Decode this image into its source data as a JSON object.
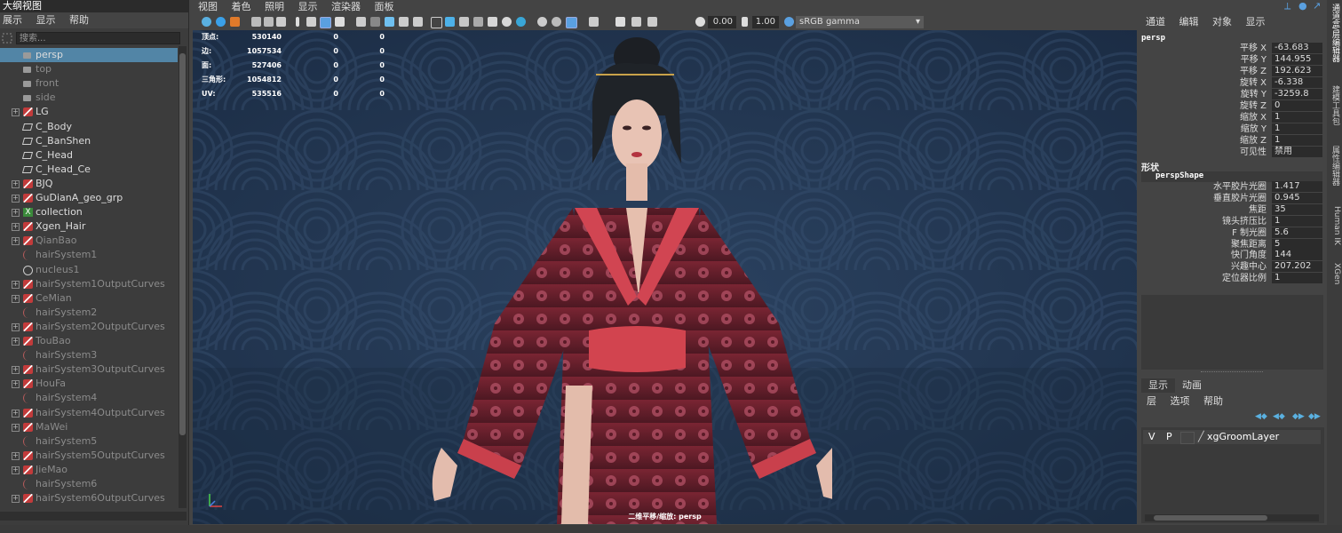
{
  "outliner": {
    "title": "大纲视图",
    "menu": [
      "展示",
      "显示",
      "帮助"
    ],
    "search_placeholder": "搜索...",
    "items": [
      {
        "label": "persp",
        "icon": "camera-icon",
        "selected": true,
        "dim": false,
        "expand": false
      },
      {
        "label": "top",
        "icon": "camera-icon",
        "selected": false,
        "dim": true,
        "expand": false
      },
      {
        "label": "front",
        "icon": "camera-icon",
        "selected": false,
        "dim": true,
        "expand": false
      },
      {
        "label": "side",
        "icon": "camera-icon",
        "selected": false,
        "dim": true,
        "expand": false
      },
      {
        "label": "LG",
        "icon": "group-icon",
        "selected": false,
        "dim": false,
        "expand": true
      },
      {
        "label": "C_Body",
        "icon": "mesh-icon",
        "selected": false,
        "dim": false,
        "expand": false
      },
      {
        "label": "C_BanShen",
        "icon": "mesh-icon",
        "selected": false,
        "dim": false,
        "expand": false
      },
      {
        "label": "C_Head",
        "icon": "mesh-icon",
        "selected": false,
        "dim": false,
        "expand": false
      },
      {
        "label": "C_Head_Ce",
        "icon": "mesh-icon",
        "selected": false,
        "dim": false,
        "expand": false
      },
      {
        "label": "BJQ",
        "icon": "group-icon",
        "selected": false,
        "dim": false,
        "expand": true
      },
      {
        "label": "GuDianA_geo_grp",
        "icon": "group-icon",
        "selected": false,
        "dim": false,
        "expand": true
      },
      {
        "label": "collection",
        "icon": "collection-icon",
        "selected": false,
        "dim": false,
        "expand": true
      },
      {
        "label": "Xgen_Hair",
        "icon": "group-icon",
        "selected": false,
        "dim": false,
        "expand": true
      },
      {
        "label": "QianBao",
        "icon": "group-icon",
        "selected": false,
        "dim": true,
        "expand": true
      },
      {
        "label": "hairSystem1",
        "icon": "curve-icon",
        "selected": false,
        "dim": true,
        "expand": false
      },
      {
        "label": "nucleus1",
        "icon": "nucleus-icon",
        "selected": false,
        "dim": true,
        "expand": false
      },
      {
        "label": "hairSystem1OutputCurves",
        "icon": "group-icon",
        "selected": false,
        "dim": true,
        "expand": true
      },
      {
        "label": "CeMian",
        "icon": "group-icon",
        "selected": false,
        "dim": true,
        "expand": true
      },
      {
        "label": "hairSystem2",
        "icon": "curve-icon",
        "selected": false,
        "dim": true,
        "expand": false
      },
      {
        "label": "hairSystem2OutputCurves",
        "icon": "group-icon",
        "selected": false,
        "dim": true,
        "expand": true
      },
      {
        "label": "TouBao",
        "icon": "group-icon",
        "selected": false,
        "dim": true,
        "expand": true
      },
      {
        "label": "hairSystem3",
        "icon": "curve-icon",
        "selected": false,
        "dim": true,
        "expand": false
      },
      {
        "label": "hairSystem3OutputCurves",
        "icon": "group-icon",
        "selected": false,
        "dim": true,
        "expand": true
      },
      {
        "label": "HouFa",
        "icon": "group-icon",
        "selected": false,
        "dim": true,
        "expand": true
      },
      {
        "label": "hairSystem4",
        "icon": "curve-icon",
        "selected": false,
        "dim": true,
        "expand": false
      },
      {
        "label": "hairSystem4OutputCurves",
        "icon": "group-icon",
        "selected": false,
        "dim": true,
        "expand": true
      },
      {
        "label": "MaWei",
        "icon": "group-icon",
        "selected": false,
        "dim": true,
        "expand": true
      },
      {
        "label": "hairSystem5",
        "icon": "curve-icon",
        "selected": false,
        "dim": true,
        "expand": false
      },
      {
        "label": "hairSystem5OutputCurves",
        "icon": "group-icon",
        "selected": false,
        "dim": true,
        "expand": true
      },
      {
        "label": "JieMao",
        "icon": "group-icon",
        "selected": false,
        "dim": true,
        "expand": true
      },
      {
        "label": "hairSystem6",
        "icon": "curve-icon",
        "selected": false,
        "dim": true,
        "expand": false
      },
      {
        "label": "hairSystem6OutputCurves",
        "icon": "group-icon",
        "selected": false,
        "dim": true,
        "expand": true
      }
    ]
  },
  "viewport": {
    "menu": [
      "视图",
      "着色",
      "照明",
      "显示",
      "渲染器",
      "面板"
    ],
    "exposure": "0.00",
    "gamma": "1.00",
    "color_space": "sRGB gamma",
    "camera_label": "二维平移/缩放: persp",
    "hud": [
      {
        "label": "顶点:",
        "v1": "530140",
        "v2": "0",
        "v3": "0"
      },
      {
        "label": "边:",
        "v1": "1057534",
        "v2": "0",
        "v3": "0"
      },
      {
        "label": "面:",
        "v1": "527406",
        "v2": "0",
        "v3": "0"
      },
      {
        "label": "三角形:",
        "v1": "1054812",
        "v2": "0",
        "v3": "0"
      },
      {
        "label": "UV:",
        "v1": "535516",
        "v2": "0",
        "v3": "0"
      }
    ]
  },
  "attribute_editor": {
    "menu": [
      "通道",
      "编辑",
      "对象",
      "显示"
    ],
    "node": "persp",
    "transform": [
      {
        "label": "平移 X",
        "value": "-63.683"
      },
      {
        "label": "平移 Y",
        "value": "144.955"
      },
      {
        "label": "平移 Z",
        "value": "192.623"
      },
      {
        "label": "旋转 X",
        "value": "-6.338"
      },
      {
        "label": "旋转 Y",
        "value": "-3259.8"
      },
      {
        "label": "旋转 Z",
        "value": "0"
      },
      {
        "label": "缩放 X",
        "value": "1"
      },
      {
        "label": "缩放 Y",
        "value": "1"
      },
      {
        "label": "缩放 Z",
        "value": "1"
      },
      {
        "label": "可见性",
        "value": "禁用"
      }
    ],
    "shape_section": "形状",
    "shape_node": "perspShape",
    "shape": [
      {
        "label": "水平胶片光圈",
        "value": "1.417"
      },
      {
        "label": "垂直胶片光圈",
        "value": "0.945"
      },
      {
        "label": "焦距",
        "value": "35"
      },
      {
        "label": "镜头挤压比",
        "value": "1"
      },
      {
        "label": "F 制光圈",
        "value": "5.6"
      },
      {
        "label": "聚焦距离",
        "value": "5"
      },
      {
        "label": "快门角度",
        "value": "144"
      },
      {
        "label": "兴趣中心",
        "value": "207.202"
      },
      {
        "label": "定位器比例",
        "value": "1"
      }
    ]
  },
  "layer_editor": {
    "tabs": [
      "显示",
      "动画"
    ],
    "menu": [
      "层",
      "选项",
      "帮助"
    ],
    "layers": [
      {
        "v": "V",
        "p": "P",
        "name": "xgGroomLayer"
      }
    ]
  },
  "side_tabs": [
    "通道盒/层编辑器",
    "建模工具包",
    "属性编辑器",
    "Human IK",
    "XGen"
  ]
}
